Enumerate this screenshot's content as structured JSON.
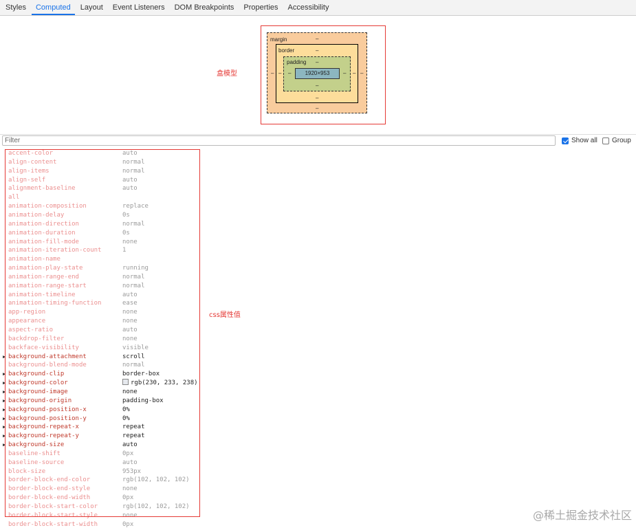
{
  "tabs": [
    {
      "label": "Styles",
      "active": false
    },
    {
      "label": "Computed",
      "active": true
    },
    {
      "label": "Layout",
      "active": false
    },
    {
      "label": "Event Listeners",
      "active": false
    },
    {
      "label": "DOM Breakpoints",
      "active": false
    },
    {
      "label": "Properties",
      "active": false
    },
    {
      "label": "Accessibility",
      "active": false
    }
  ],
  "box_model": {
    "annotation": "盒模型",
    "margin_label": "margin",
    "border_label": "border",
    "padding_label": "padding",
    "content_size": "1920×953",
    "placeholder": "–"
  },
  "filter": {
    "placeholder": "Filter",
    "show_all": "Show all",
    "show_all_checked": true,
    "group": "Group",
    "group_checked": false
  },
  "css_annotation": "css属性值",
  "properties": [
    {
      "name": "accent-color",
      "value": "auto",
      "set": false
    },
    {
      "name": "align-content",
      "value": "normal",
      "set": false
    },
    {
      "name": "align-items",
      "value": "normal",
      "set": false
    },
    {
      "name": "align-self",
      "value": "auto",
      "set": false
    },
    {
      "name": "alignment-baseline",
      "value": "auto",
      "set": false
    },
    {
      "name": "all",
      "value": "",
      "set": false
    },
    {
      "name": "animation-composition",
      "value": "replace",
      "set": false
    },
    {
      "name": "animation-delay",
      "value": "0s",
      "set": false
    },
    {
      "name": "animation-direction",
      "value": "normal",
      "set": false
    },
    {
      "name": "animation-duration",
      "value": "0s",
      "set": false
    },
    {
      "name": "animation-fill-mode",
      "value": "none",
      "set": false
    },
    {
      "name": "animation-iteration-count",
      "value": "1",
      "set": false
    },
    {
      "name": "animation-name",
      "value": "",
      "set": false
    },
    {
      "name": "animation-play-state",
      "value": "running",
      "set": false
    },
    {
      "name": "animation-range-end",
      "value": "normal",
      "set": false
    },
    {
      "name": "animation-range-start",
      "value": "normal",
      "set": false
    },
    {
      "name": "animation-timeline",
      "value": "auto",
      "set": false
    },
    {
      "name": "animation-timing-function",
      "value": "ease",
      "set": false
    },
    {
      "name": "app-region",
      "value": "none",
      "set": false
    },
    {
      "name": "appearance",
      "value": "none",
      "set": false
    },
    {
      "name": "aspect-ratio",
      "value": "auto",
      "set": false
    },
    {
      "name": "backdrop-filter",
      "value": "none",
      "set": false
    },
    {
      "name": "backface-visibility",
      "value": "visible",
      "set": false
    },
    {
      "name": "background-attachment",
      "value": "scroll",
      "set": true
    },
    {
      "name": "background-blend-mode",
      "value": "normal",
      "set": false
    },
    {
      "name": "background-clip",
      "value": "border-box",
      "set": true
    },
    {
      "name": "background-color",
      "value": "rgb(230, 233, 238)",
      "set": true,
      "swatch": "#e6e9ee"
    },
    {
      "name": "background-image",
      "value": "none",
      "set": true
    },
    {
      "name": "background-origin",
      "value": "padding-box",
      "set": true
    },
    {
      "name": "background-position-x",
      "value": "0%",
      "set": true
    },
    {
      "name": "background-position-y",
      "value": "0%",
      "set": true
    },
    {
      "name": "background-repeat-x",
      "value": "repeat",
      "set": true
    },
    {
      "name": "background-repeat-y",
      "value": "repeat",
      "set": true
    },
    {
      "name": "background-size",
      "value": "auto",
      "set": true
    },
    {
      "name": "baseline-shift",
      "value": "0px",
      "set": false
    },
    {
      "name": "baseline-source",
      "value": "auto",
      "set": false
    },
    {
      "name": "block-size",
      "value": "953px",
      "set": false
    },
    {
      "name": "border-block-end-color",
      "value": "rgb(102, 102, 102)",
      "set": false
    },
    {
      "name": "border-block-end-style",
      "value": "none",
      "set": false
    },
    {
      "name": "border-block-end-width",
      "value": "0px",
      "set": false
    },
    {
      "name": "border-block-start-color",
      "value": "rgb(102, 102, 102)",
      "set": false
    },
    {
      "name": "border-block-start-style",
      "value": "none",
      "set": false
    },
    {
      "name": "border-block-start-width",
      "value": "0px",
      "set": false
    }
  ],
  "watermark": "@稀土掘金技术社区"
}
